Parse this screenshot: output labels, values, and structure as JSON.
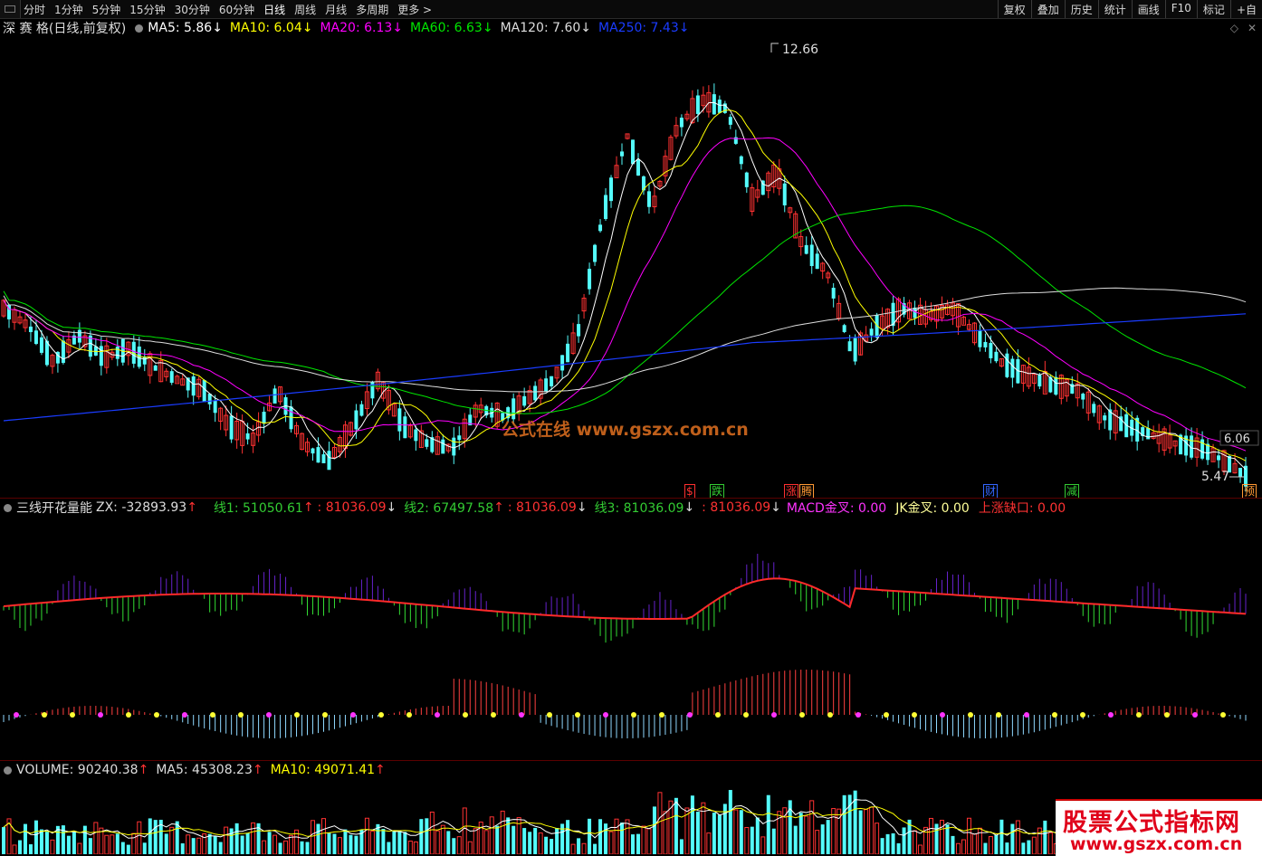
{
  "toolbar": {
    "periods": [
      "分时",
      "1分钟",
      "5分钟",
      "15分钟",
      "30分钟",
      "60分钟",
      "日线",
      "周线",
      "月线",
      "多周期",
      "更多 >"
    ],
    "active_period": "日线",
    "right": [
      "复权",
      "叠加",
      "历史",
      "统计",
      "画线",
      "F10",
      "标记",
      "+自"
    ]
  },
  "main_legend": {
    "name": "深 赛 格(日线,前复权)",
    "ma5": "MA5: 5.86",
    "ma10": "MA10: 6.04",
    "ma20": "MA20: 6.13",
    "ma60": "MA60: 6.63",
    "ma120": "MA120: 7.60",
    "ma250": "MA250: 7.43",
    "arrow": "↓"
  },
  "main_chart": {
    "high_label": "12.66",
    "low_label": "5.47",
    "last_label": "6.06",
    "badges": [
      {
        "text": "$",
        "color": "#ff3030"
      },
      {
        "text": "跌",
        "color": "#33cc33"
      },
      {
        "text": "涨",
        "color": "#ff3030"
      },
      {
        "text": "腾",
        "color": "#ff9933"
      },
      {
        "text": "财",
        "color": "#3366ff"
      },
      {
        "text": "减",
        "color": "#33cc33"
      },
      {
        "text": "预",
        "color": "#ff9933"
      }
    ],
    "watermark": "公式在线 www.gszx.com.cn"
  },
  "indicator_legend": {
    "name": "三线开花量能",
    "zx": "ZX: -32893.93",
    "up": "↑",
    "down": "↓",
    "x1": "线1: 51050.61",
    "x1b": ": 81036.09",
    "x2": "线2: 67497.58",
    "x2b": ": 81036.09",
    "x3": "线3: 81036.09",
    "x3b": ": 81036.09",
    "macd": "MACD金叉: 0.00",
    "jk": "JK金叉: 0.00",
    "gap": "上涨缺口: 0.00"
  },
  "volume_legend": {
    "vol": "VOLUME: 90240.38",
    "ma5": "MA5: 45308.23",
    "ma10": "MA10: 49071.41",
    "up": "↑"
  },
  "brand": {
    "line1": "股票公式指标网",
    "line2": "www.gszx.com.cn"
  },
  "colors": {
    "up": "#ff3232",
    "down": "#54fcfc",
    "ma5": "#ffffff",
    "ma10": "#ffff00",
    "ma20": "#ff00ff",
    "ma60": "#00e600",
    "ma120": "#dddddd",
    "ma250": "#1a3cff"
  }
}
